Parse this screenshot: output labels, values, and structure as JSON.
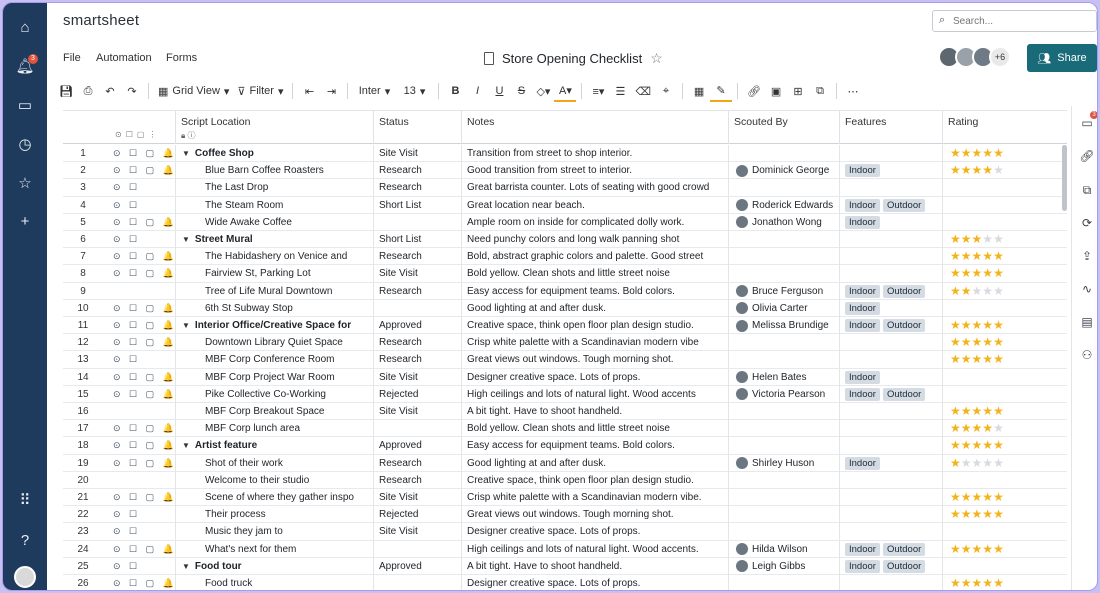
{
  "app": {
    "logo": "smartsheet"
  },
  "search": {
    "placeholder": "Search..."
  },
  "menu": {
    "file": "File",
    "automation": "Automation",
    "forms": "Forms"
  },
  "sheet": {
    "title": "Store Opening Checklist"
  },
  "collaborators": {
    "more": "+6"
  },
  "share": {
    "label": "Share"
  },
  "notifications": {
    "count": "3"
  },
  "toolbar": {
    "grid_view": "Grid View",
    "filter": "Filter",
    "font": "Inter",
    "size": "13"
  },
  "columns": {
    "location": "Script Location",
    "status": "Status",
    "notes": "Notes",
    "scouted_by": "Scouted By",
    "features": "Features",
    "rating": "Rating"
  },
  "rows": [
    {
      "n": "1",
      "icons": "⊙ ☐ ▢ 🔔",
      "loc": "Coffee Shop",
      "parent": true,
      "status": "Site Visit",
      "notes": "Transition from street to shop interior.",
      "scout": "",
      "features": [],
      "rating": 5
    },
    {
      "n": "2",
      "icons": "⊙ ☐ ▢ 🔔",
      "loc": "Blue Barn Coffee Roasters",
      "parent": false,
      "status": "Research",
      "notes": "Good transition from street to interior.",
      "scout": "Dominick George",
      "features": [
        "Indoor"
      ],
      "rating": 4
    },
    {
      "n": "3",
      "icons": "⊙ ☐",
      "loc": "The Last Drop",
      "parent": false,
      "status": "Research",
      "notes": "Great barrista counter. Lots of seating with good crowd",
      "scout": "",
      "features": [],
      "rating": 0
    },
    {
      "n": "4",
      "icons": "⊙ ☐",
      "loc": "The Steam Room",
      "parent": false,
      "status": "Short List",
      "notes": "Great location near beach.",
      "scout": "Roderick Edwards",
      "features": [
        "Indoor",
        "Outdoor"
      ],
      "rating": 0
    },
    {
      "n": "5",
      "icons": "⊙ ☐ ▢ 🔔",
      "loc": "Wide Awake Coffee",
      "parent": false,
      "status": "",
      "notes": "Ample room on inside for complicated dolly work.",
      "scout": "Jonathon Wong",
      "features": [
        "Indoor"
      ],
      "rating": 0
    },
    {
      "n": "6",
      "icons": "⊙ ☐",
      "loc": "Street Mural",
      "parent": true,
      "status": "Short List",
      "notes": "Need punchy colors and long walk panning shot",
      "scout": "",
      "features": [],
      "rating": 3
    },
    {
      "n": "7",
      "icons": "⊙ ☐ ▢ 🔔",
      "loc": "The Habidashery on Venice and",
      "parent": false,
      "status": "Research",
      "notes": "Bold, abstract graphic colors and palette. Good street",
      "scout": "",
      "features": [],
      "rating": 5
    },
    {
      "n": "8",
      "icons": "⊙ ☐ ▢ 🔔",
      "loc": "Fairview St, Parking Lot",
      "parent": false,
      "status": "Site Visit",
      "notes": "Bold yellow. Clean shots and little street noise",
      "scout": "",
      "features": [],
      "rating": 5
    },
    {
      "n": "9",
      "icons": "",
      "loc": "Tree of Life Mural Downtown",
      "parent": false,
      "status": "Research",
      "notes": "Easy access for equipment teams. Bold colors.",
      "scout": "Bruce Ferguson",
      "features": [
        "Indoor",
        "Outdoor"
      ],
      "rating": 2
    },
    {
      "n": "10",
      "icons": "⊙ ☐ ▢ 🔔",
      "loc": "6th St Subway Stop",
      "parent": false,
      "status": "",
      "notes": "Good lighting at and after dusk.",
      "scout": "Olivia Carter",
      "features": [
        "Indoor"
      ],
      "rating": 0
    },
    {
      "n": "11",
      "icons": "⊙ ☐ ▢ 🔔",
      "loc": "Interior Office/Creative Space for",
      "parent": true,
      "status": "Approved",
      "notes": "Creative space, think open floor plan design studio.",
      "scout": "Melissa Brundige",
      "features": [
        "Indoor",
        "Outdoor"
      ],
      "rating": 5
    },
    {
      "n": "12",
      "icons": "⊙ ☐ ▢ 🔔",
      "loc": "Downtown Library Quiet Space",
      "parent": false,
      "status": "Research",
      "notes": "Crisp white palette with a Scandinavian modern vibe",
      "scout": "",
      "features": [],
      "rating": 5
    },
    {
      "n": "13",
      "icons": "⊙ ☐",
      "loc": "MBF Corp Conference Room",
      "parent": false,
      "status": "Research",
      "notes": "Great views out windows. Tough morning shot.",
      "scout": "",
      "features": [],
      "rating": 5
    },
    {
      "n": "14",
      "icons": "⊙ ☐ ▢ 🔔",
      "loc": "MBF Corp Project War Room",
      "parent": false,
      "status": "Site Visit",
      "notes": "Designer creative space. Lots of props.",
      "scout": "Helen Bates",
      "features": [
        "Indoor"
      ],
      "rating": 0
    },
    {
      "n": "15",
      "icons": "⊙ ☐ ▢ 🔔",
      "loc": "Pike Collective Co-Working",
      "parent": false,
      "status": "Rejected",
      "notes": "High ceilings and lots of natural light. Wood accents",
      "scout": "Victoria Pearson",
      "features": [
        "Indoor",
        "Outdoor"
      ],
      "rating": 0
    },
    {
      "n": "16",
      "icons": "",
      "loc": "MBF Corp Breakout Space",
      "parent": false,
      "status": "Site Visit",
      "notes": "A bit tight. Have to shoot handheld.",
      "scout": "",
      "features": [],
      "rating": 5
    },
    {
      "n": "17",
      "icons": "⊙ ☐ ▢ 🔔",
      "loc": "MBF Corp lunch area",
      "parent": false,
      "status": "",
      "notes": "Bold yellow. Clean shots and little street noise",
      "scout": "",
      "features": [],
      "rating": 4
    },
    {
      "n": "18",
      "icons": "⊙ ☐ ▢ 🔔",
      "loc": "Artist feature",
      "parent": true,
      "status": "Approved",
      "notes": "Easy access for equipment teams. Bold colors.",
      "scout": "",
      "features": [],
      "rating": 5
    },
    {
      "n": "19",
      "icons": "⊙ ☐ ▢ 🔔",
      "loc": "Shot of their work",
      "parent": false,
      "status": "Research",
      "notes": "Good lighting at and after dusk.",
      "scout": "Shirley Huson",
      "features": [
        "Indoor"
      ],
      "rating": 1
    },
    {
      "n": "20",
      "icons": "",
      "loc": "Welcome to their studio",
      "parent": false,
      "status": "Research",
      "notes": "Creative space, think open floor plan design studio.",
      "scout": "",
      "features": [],
      "rating": 0
    },
    {
      "n": "21",
      "icons": "⊙ ☐ ▢ 🔔",
      "loc": "Scene of where they gather inspo",
      "parent": false,
      "status": "Site Visit",
      "notes": "Crisp white palette with a Scandinavian modern vibe.",
      "scout": "",
      "features": [],
      "rating": 5
    },
    {
      "n": "22",
      "icons": "⊙ ☐",
      "loc": "Their process",
      "parent": false,
      "status": "Rejected",
      "notes": "Great views out windows. Tough morning shot.",
      "scout": "",
      "features": [],
      "rating": 5
    },
    {
      "n": "23",
      "icons": "⊙ ☐",
      "loc": "Music they jam to",
      "parent": false,
      "status": "Site Visit",
      "notes": "Designer creative space. Lots of props.",
      "scout": "",
      "features": [],
      "rating": 0
    },
    {
      "n": "24",
      "icons": "⊙ ☐ ▢ 🔔",
      "loc": "What's next for them",
      "parent": false,
      "status": "",
      "notes": "High ceilings and lots of natural light. Wood accents.",
      "scout": "Hilda Wilson",
      "features": [
        "Indoor",
        "Outdoor"
      ],
      "rating": 5
    },
    {
      "n": "25",
      "icons": "⊙ ☐",
      "loc": "Food tour",
      "parent": true,
      "status": "Approved",
      "notes": "A bit tight. Have to shoot handheld.",
      "scout": "Leigh Gibbs",
      "features": [
        "Indoor",
        "Outdoor"
      ],
      "rating": 0
    },
    {
      "n": "26",
      "icons": "⊙ ☐ ▢ 🔔",
      "loc": "Food truck",
      "parent": false,
      "status": "",
      "notes": "Designer creative space. Lots of props.",
      "scout": "",
      "features": [],
      "rating": 5
    }
  ]
}
